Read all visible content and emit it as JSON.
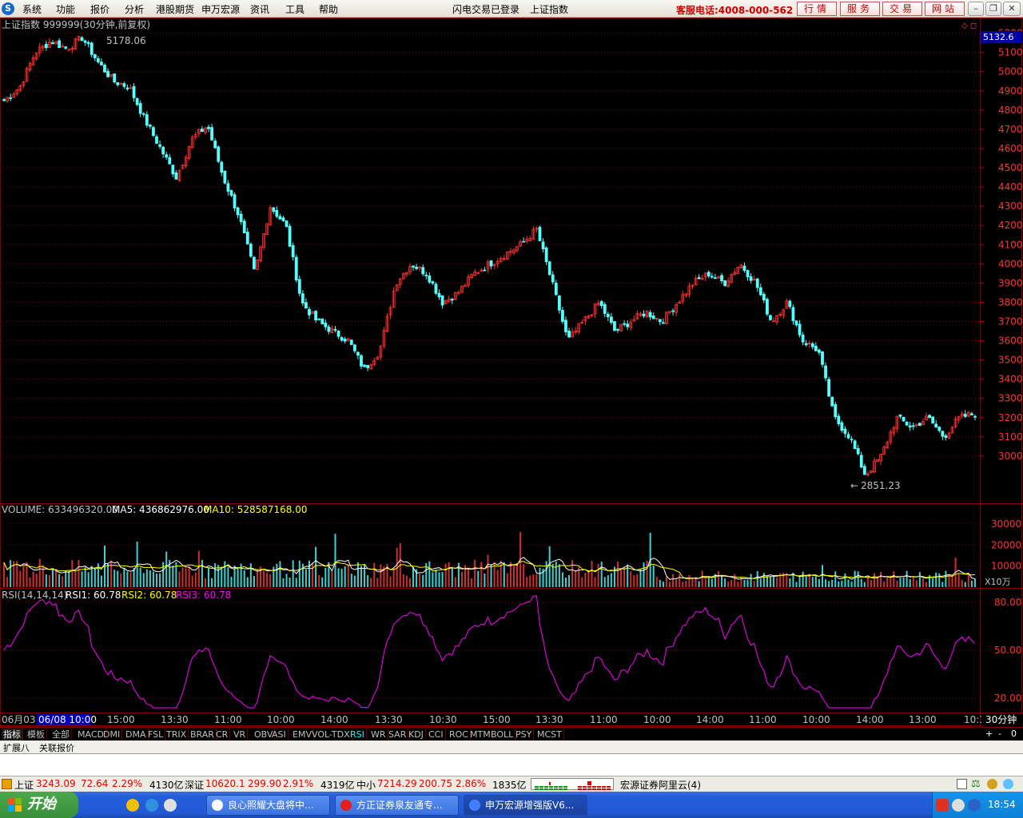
{
  "menubar": {
    "items": [
      "系统",
      "功能",
      "报价",
      "分析",
      "港股期货",
      "申万宏源",
      "资讯",
      "工具",
      "帮助"
    ],
    "center": [
      "闪电交易已登录",
      "上证指数"
    ],
    "hotline": "客服电话:4008-000-562",
    "buttons": [
      "行情",
      "服务",
      "交易",
      "网站"
    ]
  },
  "chart": {
    "title": "上证指数 999999(30分钟,前复权)",
    "current_price_tag": "5132.6",
    "high_label": "5178.06",
    "low_label": "2851.23",
    "price_axis": [
      "5200",
      "5100",
      "5000",
      "4900",
      "4800",
      "4700",
      "4600",
      "4500",
      "4400",
      "4300",
      "4200",
      "4100",
      "4000",
      "3900",
      "3800",
      "3700",
      "3600",
      "3500",
      "3400",
      "3300",
      "3200",
      "3100",
      "3000"
    ],
    "volume_header": {
      "label": "VOLUME: 633496320.00",
      "ma5": "MA5: 436862976.00",
      "ma10": "MA10: 528587168.00"
    },
    "volume_axis": [
      "30000",
      "20000",
      "10000"
    ],
    "volume_unit": "X10万",
    "rsi_header": {
      "label": "RSI(14,14,14)",
      "rsi1": "RSI1: 60.78",
      "rsi2": "RSI2: 60.78",
      "rsi3": "RSI3: 60.78"
    },
    "rsi_axis": [
      "80.00",
      "50.00",
      "20.00"
    ],
    "time_axis": [
      "06月03",
      "06/08 10:00",
      "15:00",
      "13:30",
      "11:00",
      "10:00",
      "14:00",
      "13:30",
      "10:30",
      "15:00",
      "13:30",
      "11:00",
      "10:00",
      "14:00",
      "11:00",
      "10:00",
      "14:00",
      "13:00",
      "10:3"
    ],
    "period": "30分钟"
  },
  "chart_data": {
    "type": "candlestick",
    "title": "上证指数 999999(30分钟,前复权)",
    "ylim": [
      2800,
      5230
    ],
    "high": 5178.06,
    "low": 2851.23,
    "last": 5132.6,
    "anchor_closes": [
      4850,
      4920,
      5100,
      5160,
      5120,
      5178,
      5050,
      4950,
      4920,
      4750,
      4600,
      4450,
      4650,
      4720,
      4450,
      4250,
      3950,
      4300,
      4200,
      3800,
      3700,
      3650,
      3600,
      3450,
      3550,
      3900,
      4000,
      3950,
      3800,
      3850,
      3950,
      4000,
      4050,
      4100,
      4180,
      3900,
      3600,
      3700,
      3800,
      3650,
      3700,
      3750,
      3700,
      3800,
      3900,
      3950,
      3900,
      4000,
      3900,
      3700,
      3800,
      3600,
      3550,
      3200,
      3100,
      2900,
      3000,
      3200,
      3150,
      3200,
      3100,
      3200,
      3220
    ],
    "volume_axis_ticks": [
      10000,
      20000,
      30000
    ],
    "rsi": {
      "axis_ticks": [
        20,
        50,
        80
      ],
      "last": 60.78
    }
  },
  "tabs": [
    "指标",
    "模板",
    "全部",
    "MACD",
    "DMI",
    "DMA",
    "FSL",
    "TRIX",
    "BRAR",
    "CR",
    "VR",
    "OBV",
    "ASI",
    "EMV",
    "VOL-TDX",
    "RSI",
    "WR",
    "SAR",
    "KDJ",
    "CCI",
    "ROC",
    "MTM",
    "BOLL",
    "PSY",
    "MCST"
  ],
  "tab_controls": [
    "+",
    "-",
    "0"
  ],
  "extbar": [
    "扩展八",
    "关联报价"
  ],
  "statusbar": {
    "sh_label": "上证",
    "sh_value": "3243.09",
    "sh_change": "72.64",
    "sh_pct": "2.29%",
    "sh_amount": "4130亿",
    "sz_label": "深证",
    "sz_value": "10620.1",
    "sz_change": "299.90",
    "sz_pct": "2.91%",
    "sz_amount": "4319亿",
    "zx_label": "中小",
    "zx_value": "7214.29",
    "zx_change": "200.75",
    "zx_pct": "2.86%",
    "zx_amount": "1835亿",
    "server": "宏源证券阿里云(4)"
  },
  "taskbar": {
    "start": "开始",
    "tasks": [
      "良心照耀大盘将中...",
      "方正证券泉友通专...",
      "申万宏源增强版V6..."
    ],
    "clock": "18:54"
  },
  "colors": {
    "up": "#ff3232",
    "down": "#54ffff",
    "ma5": "#ffffff",
    "ma10": "#ffff00",
    "rsi": "#ff00ff",
    "grid": "#800000"
  }
}
